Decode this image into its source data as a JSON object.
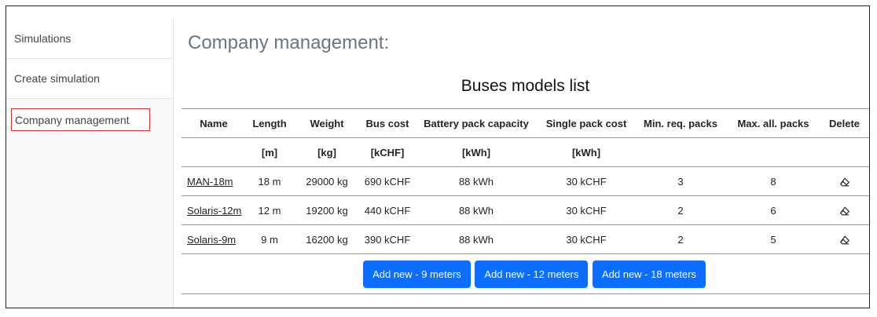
{
  "sidebar": {
    "items": [
      {
        "label": "Simulations"
      },
      {
        "label": "Create simulation"
      },
      {
        "label": "Company management"
      }
    ]
  },
  "page": {
    "title": "Company management:"
  },
  "buses": {
    "title": "Buses models list",
    "columns": [
      "Name",
      "Length",
      "Weight",
      "Bus cost",
      "Battery pack capacity",
      "Single pack cost",
      "Min. req. packs",
      "Max. all. packs",
      "Delete"
    ],
    "units": [
      "",
      "[m]",
      "[kg]",
      "[kCHF]",
      "[kWh]",
      "[kWh]",
      "",
      "",
      ""
    ],
    "rows": [
      {
        "name": "MAN-18m",
        "length": "18 m",
        "weight": "29000 kg",
        "cost": "690 kCHF",
        "capacity": "88 kWh",
        "pack_cost": "30 kCHF",
        "min": "3",
        "max": "8"
      },
      {
        "name": "Solaris-12m",
        "length": "12 m",
        "weight": "19200 kg",
        "cost": "440 kCHF",
        "capacity": "88 kWh",
        "pack_cost": "30 kCHF",
        "min": "2",
        "max": "6"
      },
      {
        "name": "Solaris-9m",
        "length": "9 m",
        "weight": "16200 kg",
        "cost": "390 kCHF",
        "capacity": "88 kWh",
        "pack_cost": "30 kCHF",
        "min": "2",
        "max": "5"
      }
    ],
    "delete_icon": "eraser-icon",
    "buttons": [
      "Add new - 9 meters",
      "Add new - 12 meters",
      "Add new - 18 meters"
    ]
  },
  "colors": {
    "accent": "#0d6efd",
    "highlight_border": "#d03a3a"
  }
}
